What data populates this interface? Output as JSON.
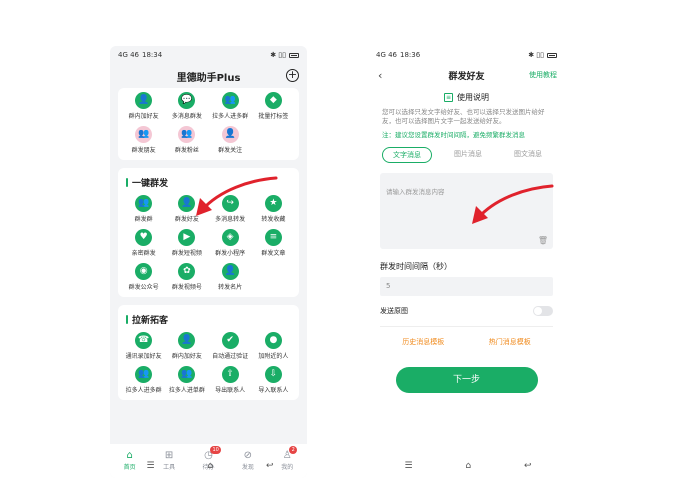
{
  "left": {
    "status": {
      "carrier": "4G 46",
      "time": "18:34",
      "icons": "✱ ▯▯"
    },
    "title": "里德助手Plus",
    "top_items": [
      {
        "label": "群内加好友",
        "icon": "person-icon",
        "glyph": "👤",
        "style": "green"
      },
      {
        "label": "多消息群发",
        "icon": "chat-bubble-icon",
        "glyph": "💬",
        "style": "green"
      },
      {
        "label": "拉多人进多群",
        "icon": "group-chat-icon",
        "glyph": "👥",
        "style": "green"
      },
      {
        "label": "批量打标签",
        "icon": "tag-icon",
        "glyph": "◆",
        "style": "green"
      },
      {
        "label": "群发朋友",
        "icon": "friends-icon",
        "glyph": "👥",
        "style": "pink"
      },
      {
        "label": "群发粉丝",
        "icon": "fans-icon",
        "glyph": "👥",
        "style": "pink"
      },
      {
        "label": "群发关注",
        "icon": "follow-icon",
        "glyph": "👤",
        "style": "pink"
      }
    ],
    "section1": {
      "title": "一键群发",
      "items": [
        {
          "label": "群发群",
          "icon": "group-icon",
          "glyph": "👥"
        },
        {
          "label": "群发好友",
          "icon": "person-icon",
          "glyph": "👤"
        },
        {
          "label": "多消息转发",
          "icon": "share-icon",
          "glyph": "↪"
        },
        {
          "label": "转发收藏",
          "icon": "star-icon",
          "glyph": "★"
        },
        {
          "label": "亲密群发",
          "icon": "heart-icon",
          "glyph": "♥"
        },
        {
          "label": "群发短视频",
          "icon": "video-icon",
          "glyph": "▶"
        },
        {
          "label": "群发小程序",
          "icon": "mini-program-icon",
          "glyph": "◈"
        },
        {
          "label": "群发文章",
          "icon": "article-icon",
          "glyph": "≡"
        },
        {
          "label": "群发公众号",
          "icon": "official-account-icon",
          "glyph": "◉"
        },
        {
          "label": "群发视频号",
          "icon": "channels-icon",
          "glyph": "✿"
        },
        {
          "label": "转发名片",
          "icon": "card-icon",
          "glyph": "👤"
        }
      ]
    },
    "section2": {
      "title": "拉新拓客",
      "items": [
        {
          "label": "通讯录加好友",
          "icon": "contacts-icon",
          "glyph": "☎"
        },
        {
          "label": "群内加好友",
          "icon": "person-add-icon",
          "glyph": "👤"
        },
        {
          "label": "自动通过验证",
          "icon": "verify-icon",
          "glyph": "✔"
        },
        {
          "label": "加附近的人",
          "icon": "nearby-icon",
          "glyph": "●"
        },
        {
          "label": "拉多人进多群",
          "icon": "group-invite-icon",
          "glyph": "👥"
        },
        {
          "label": "拉多人进单群",
          "icon": "group-invite-single-icon",
          "glyph": "👥"
        },
        {
          "label": "导出联系人",
          "icon": "export-icon",
          "glyph": "⇪"
        },
        {
          "label": "导入联系人",
          "icon": "import-icon",
          "glyph": "⇩"
        }
      ]
    },
    "tabs": [
      {
        "label": "首页",
        "icon": "home-icon",
        "glyph": "⌂",
        "active": true,
        "badge": ""
      },
      {
        "label": "工具",
        "icon": "tools-icon",
        "glyph": "⊞",
        "active": false,
        "badge": ""
      },
      {
        "label": "待办",
        "icon": "clock-icon",
        "glyph": "◷",
        "active": false,
        "badge": "10"
      },
      {
        "label": "发现",
        "icon": "compass-icon",
        "glyph": "⊘",
        "active": false,
        "badge": ""
      },
      {
        "label": "我的",
        "icon": "profile-icon",
        "glyph": "♙",
        "active": false,
        "badge": "2"
      }
    ]
  },
  "right": {
    "status": {
      "carrier": "4G 46",
      "time": "18:36",
      "icons": "✱ ▯▯"
    },
    "title": "群发好友",
    "help_link": "使用教程",
    "usage_title": "使用说明",
    "description": "您可以选择只发文字给好友、也可以选择只发送图片给好友，也可以选择图片文字一起发送给好友。",
    "note": "注：建议您设置群发时间间隔，避免频繁群发消息",
    "segments": [
      {
        "label": "文字消息",
        "active": true
      },
      {
        "label": "图片消息",
        "active": false
      },
      {
        "label": "图文消息",
        "active": false
      }
    ],
    "message_placeholder": "请输入群发消息内容",
    "interval_label": "群发时间间隔（秒）",
    "interval_value": "5",
    "send_original_label": "发送原图",
    "history_template": "历史消息模板",
    "hot_template": "热门消息模板",
    "next_button": "下一步"
  },
  "colors": {
    "accent": "#1aad66",
    "arrow": "#e0222c",
    "template": "#f08a1c"
  }
}
